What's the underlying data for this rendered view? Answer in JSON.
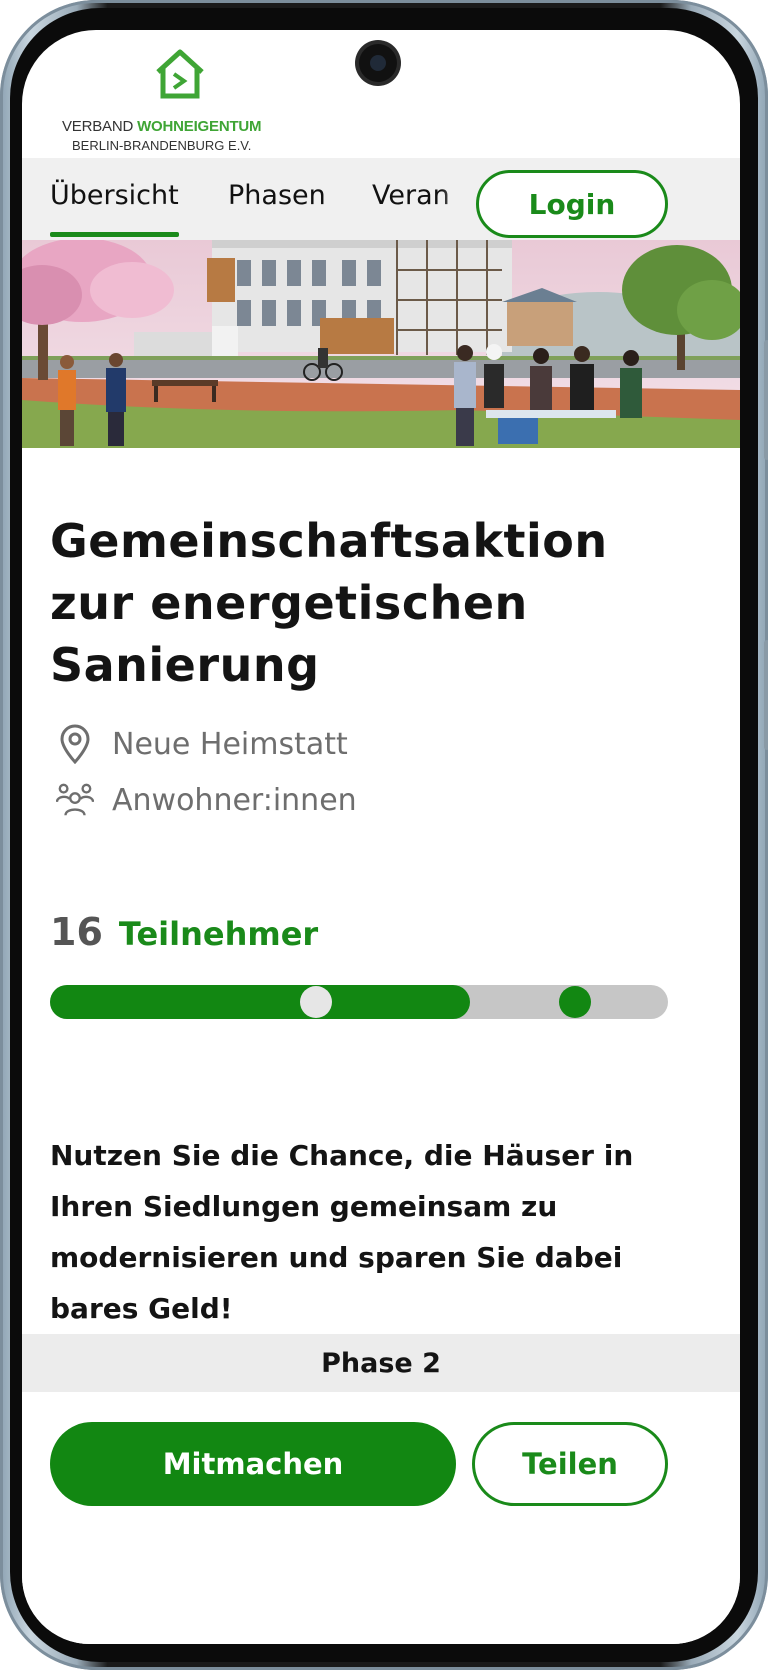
{
  "header": {
    "logo_line1_a": "VERBAND ",
    "logo_line1_b": "WOHNEIGENTUM",
    "logo_line2": "BERLIN-BRANDENBURG E.V."
  },
  "nav": {
    "tabs": [
      {
        "label": "Übersicht",
        "active": true
      },
      {
        "label": "Phasen",
        "active": false
      },
      {
        "label": "Veran",
        "active": false
      }
    ],
    "login_label": "Login"
  },
  "project": {
    "title": "Gemeinschaftsaktion zur energetischen Sanierung",
    "location": "Neue Heimstatt",
    "audience": "Anwohner:innen",
    "participants_count": "16",
    "participants_label": "Teilnehmer",
    "progress_fraction": 0.68,
    "milestones": [
      0.43,
      0.85
    ],
    "description": "Nutzen Sie die Chance, die Häuser in Ihren Siedlungen gemeinsam zu modernisieren und sparen Sie dabei bares Geld!",
    "phase_label": "Phase 2"
  },
  "actions": {
    "primary_label": "Mitmachen",
    "secondary_label": "Teilen"
  },
  "colors": {
    "brand_green": "#128712",
    "logo_green": "#3fa535",
    "track_grey": "#c6c6c6"
  },
  "icons": {
    "location": "location-pin-icon",
    "people": "people-icon",
    "logo": "house-logo-icon"
  }
}
